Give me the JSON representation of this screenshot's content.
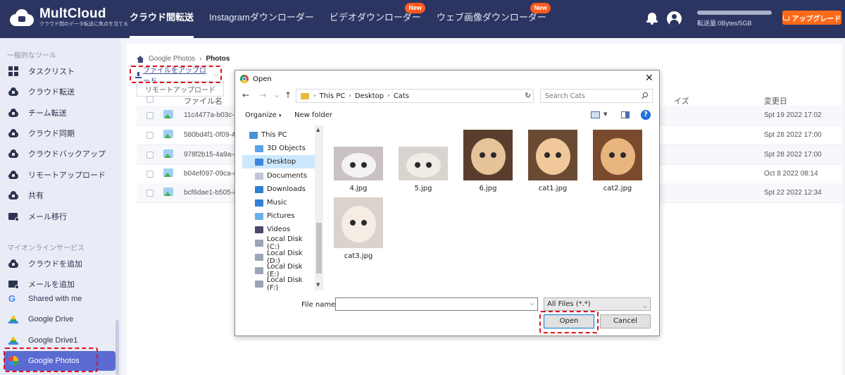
{
  "brand": {
    "name": "MultCloud",
    "tagline": "クラウド間のデータ転送に焦点を当てる"
  },
  "nav": {
    "items": [
      {
        "label": "クラウド間転送",
        "active": true,
        "badge": ""
      },
      {
        "label": "Instagramダウンローダー",
        "active": false,
        "badge": ""
      },
      {
        "label": "ビデオダウンローダー",
        "active": false,
        "badge": "New"
      },
      {
        "label": "ウェブ画像ダウンローダー",
        "active": false,
        "badge": "New"
      }
    ]
  },
  "header": {
    "storage_text": "転送量:0Bytes/5GB",
    "storage_used_fraction": 0.0,
    "upgrade_label": "アップグレード"
  },
  "sidebar": {
    "section_tools": "一般的なツール",
    "tools": [
      {
        "label": "タスクリスト",
        "icon": "grid-icon"
      },
      {
        "label": "クラウド転送",
        "icon": "cloud-transfer-icon"
      },
      {
        "label": "チーム転送",
        "icon": "team-transfer-icon"
      },
      {
        "label": "クラウド同期",
        "icon": "cloud-sync-icon"
      },
      {
        "label": "クラウドバックアップ",
        "icon": "cloud-backup-icon"
      },
      {
        "label": "リモートアップロード",
        "icon": "remote-upload-icon"
      },
      {
        "label": "共有",
        "icon": "share-icon"
      },
      {
        "label": "メール移行",
        "icon": "mail-migration-icon"
      }
    ],
    "section_services": "マイオンラインサービス",
    "services": [
      {
        "label": "クラウドを追加",
        "icon": "add-cloud-icon"
      },
      {
        "label": "メールを追加",
        "icon": "add-mail-icon"
      },
      {
        "label": "Shared with me",
        "icon": "google-icon"
      },
      {
        "label": "Google Drive",
        "icon": "google-drive-icon"
      },
      {
        "label": "Google Drive1",
        "icon": "google-drive-icon"
      },
      {
        "label": "Google Photos",
        "icon": "google-photos-icon",
        "active": true
      }
    ]
  },
  "main": {
    "breadcrumb": [
      "Google Photos",
      "Photos"
    ],
    "upload_label": "ファイルをアップロード",
    "upload_menu_item": "リモートアップロード",
    "columns": {
      "name": "ファイル名",
      "size": "イズ",
      "date": "変更日"
    },
    "rows": [
      {
        "name": "11c4477a-b03c-4",
        "date": "Spt 19 2022 17:02"
      },
      {
        "name": "580bd4f1-0f09-4b",
        "date": "Spt 28 2022 17:00"
      },
      {
        "name": "978f2b15-4a9a-4",
        "date": "Spt 28 2022 17:00"
      },
      {
        "name": "b04ef097-09ca-4e",
        "date": "Oct 8 2022 08:14"
      },
      {
        "name": "bcf6dae1-b505-4",
        "date": "Spt 22 2022 12:34"
      }
    ]
  },
  "dialog": {
    "title": "Open",
    "path": [
      "This PC",
      "Desktop",
      "Cats"
    ],
    "search_placeholder": "Search Cats",
    "organize_label": "Organize",
    "new_folder_label": "New folder",
    "tree": [
      {
        "label": "This PC",
        "color": "#4a8fd8"
      },
      {
        "label": "3D Objects",
        "color": "#5aa0e8"
      },
      {
        "label": "Desktop",
        "color": "#3a86d8",
        "selected": true
      },
      {
        "label": "Documents",
        "color": "#bfc7d4"
      },
      {
        "label": "Downloads",
        "color": "#2f7fd6"
      },
      {
        "label": "Music",
        "color": "#2f7fd6"
      },
      {
        "label": "Pictures",
        "color": "#6bb0e8"
      },
      {
        "label": "Videos",
        "color": "#4a4a6a"
      },
      {
        "label": "Local Disk (C:)",
        "color": "#9aa5b5"
      },
      {
        "label": "Local Disk (D:)",
        "color": "#9aa5b5"
      },
      {
        "label": "Local Disk (E:)",
        "color": "#9aa5b5"
      },
      {
        "label": "Local Disk (F:)",
        "color": "#9aa5b5"
      }
    ],
    "files": [
      {
        "name": "4.jpg",
        "bg": "#c9c1c4",
        "fur": "#f4f2f4"
      },
      {
        "name": "5.jpg",
        "bg": "#d8d4cf",
        "fur": "#f1ece6"
      },
      {
        "name": "6.jpg",
        "bg": "#5a3e2d",
        "fur": "#e7c39a"
      },
      {
        "name": "cat1.jpg",
        "bg": "#6b4a34",
        "fur": "#f0c89a"
      },
      {
        "name": "cat2.jpg",
        "bg": "#7a4a2e",
        "fur": "#e9b57f"
      },
      {
        "name": "cat3.jpg",
        "bg": "#d9d3cc",
        "fur": "#f5ece3"
      }
    ],
    "file_name_label": "File name:",
    "file_name_value": "",
    "filter_value": "All Files (*.*)",
    "open_label": "Open",
    "cancel_label": "Cancel"
  },
  "colors": {
    "topbar": "#2c3561",
    "accent": "#5b6bd1",
    "upgrade": "#ff6a1a",
    "badge": "#ff5a1f",
    "highlight": "#e0101e"
  }
}
